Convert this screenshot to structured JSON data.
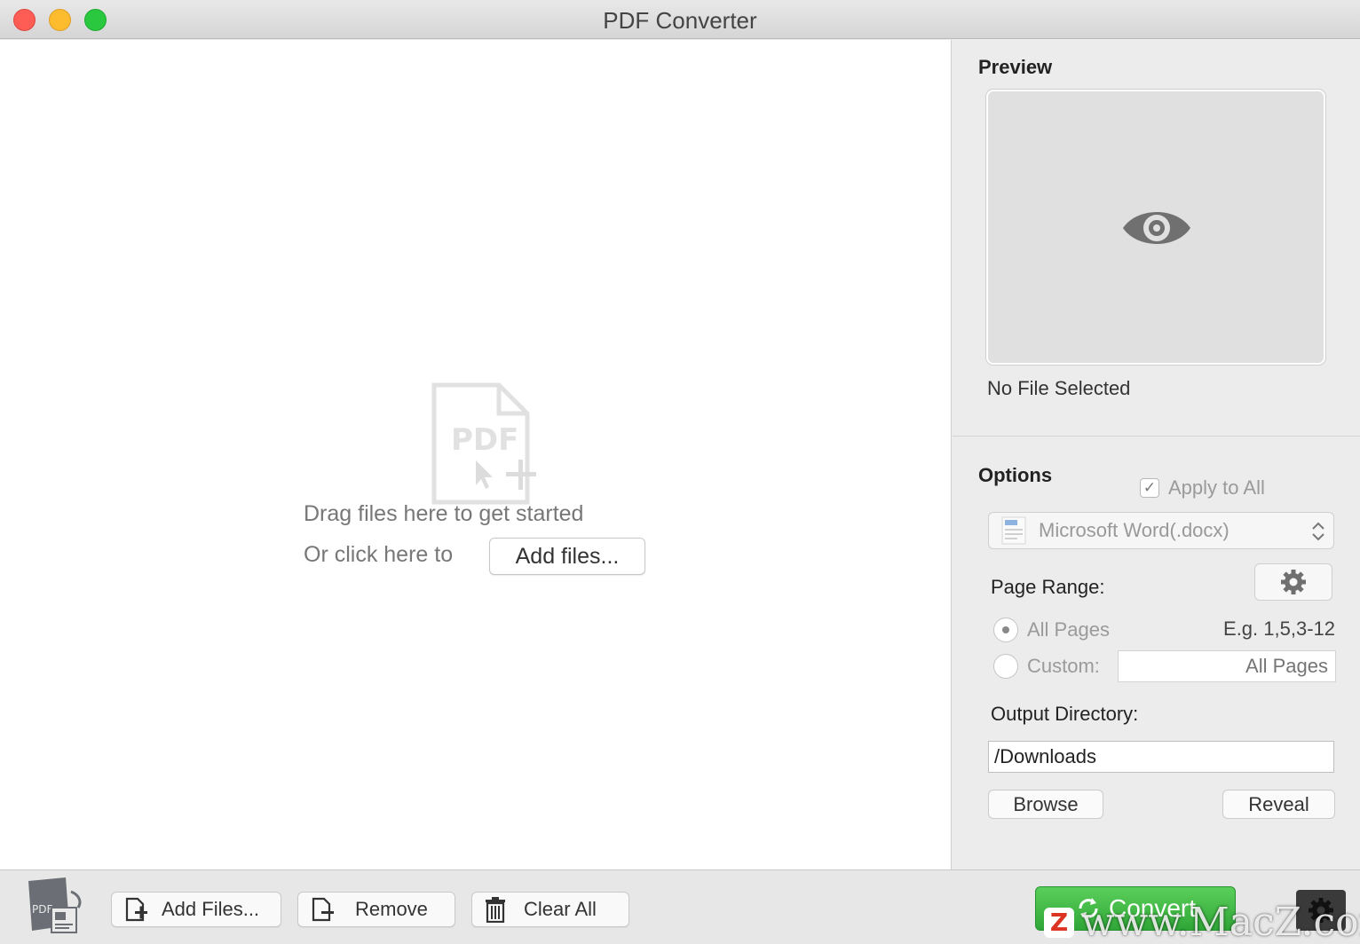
{
  "window": {
    "title": "PDF Converter"
  },
  "drop_zone": {
    "icon_label": "PDF",
    "drag_text": "Drag files here to get started",
    "or_text": "Or click here to",
    "add_files_label": "Add files..."
  },
  "preview": {
    "heading": "Preview",
    "status": "No File Selected"
  },
  "options": {
    "heading": "Options",
    "apply_to_all_label": "Apply to All",
    "apply_to_all_checked": true,
    "format_selected": "Microsoft Word(.docx)",
    "page_range_label": "Page Range:",
    "all_pages_label": "All Pages",
    "custom_label": "Custom:",
    "example_text": "E.g. 1,5,3-12",
    "custom_placeholder": "All Pages",
    "output_directory_label": "Output Directory:",
    "output_directory_value": "/Downloads",
    "browse_label": "Browse",
    "reveal_label": "Reveal"
  },
  "footer": {
    "app_icon_label": "PDF",
    "add_files_label": "Add Files...",
    "remove_label": "Remove",
    "clear_all_label": "Clear All",
    "convert_label": "Convert"
  },
  "watermark": {
    "text": "www.MacZ.com",
    "badge": "Z"
  },
  "colors": {
    "convert_green": "#2fa637",
    "close": "#fd5d55",
    "minimize": "#fdbb2e",
    "maximize": "#29c83f"
  }
}
